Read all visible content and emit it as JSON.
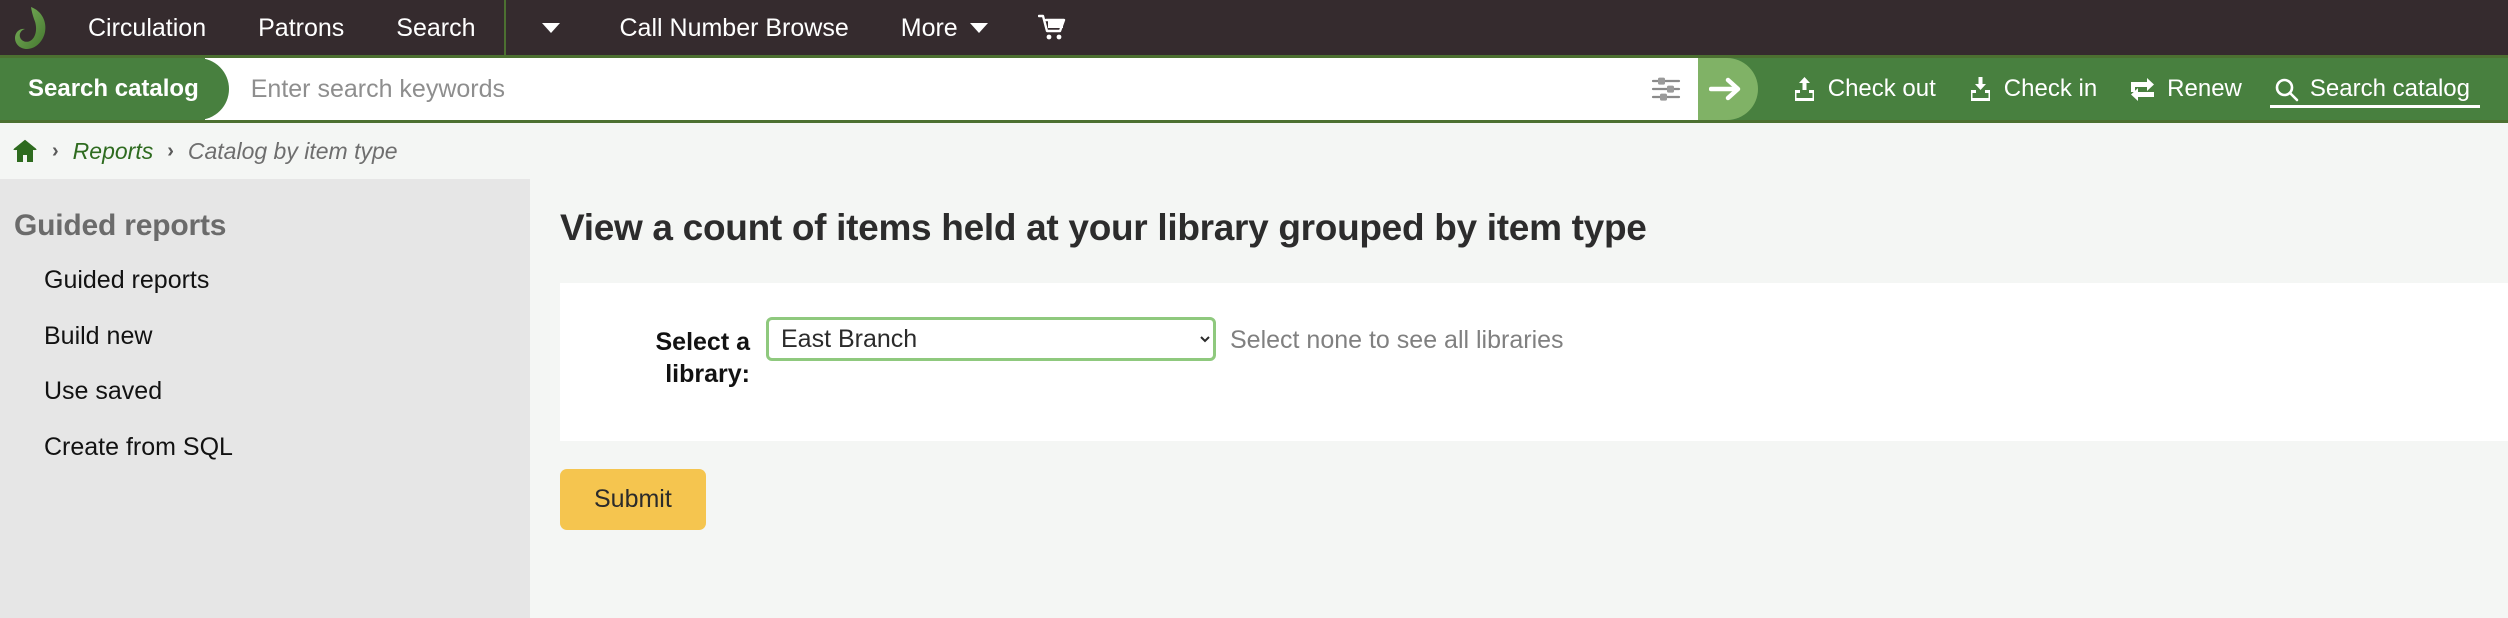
{
  "nav": {
    "logo_label": "koha-leaf-logo",
    "items": [
      {
        "label": "Circulation",
        "name": "nav-circulation"
      },
      {
        "label": "Patrons",
        "name": "nav-patrons"
      },
      {
        "label": "Search",
        "name": "nav-search"
      }
    ],
    "dropdown_caret_label": "",
    "call_number_browse": "Call Number Browse",
    "more": "More",
    "cart_label": "cart-icon"
  },
  "search": {
    "tab_label": "Search catalog",
    "placeholder": "Enter search keywords",
    "value": "",
    "filter_icon": "sliders-icon",
    "submit_icon": "arrow-right-icon",
    "actions": [
      {
        "label": "Check out",
        "icon": "check-out-icon",
        "active": false
      },
      {
        "label": "Check in",
        "icon": "check-in-icon",
        "active": false
      },
      {
        "label": "Renew",
        "icon": "renew-icon",
        "active": false
      },
      {
        "label": "Search catalog",
        "icon": "magnifier-icon",
        "active": true
      }
    ]
  },
  "breadcrumb": {
    "home_icon": "home-icon",
    "separator": "›",
    "items": [
      {
        "label": "Reports",
        "link": true
      },
      {
        "label": "Catalog by item type",
        "link": false
      }
    ]
  },
  "sidebar": {
    "heading": "Guided reports",
    "items": [
      {
        "label": "Guided reports"
      },
      {
        "label": "Build new"
      },
      {
        "label": "Use saved"
      },
      {
        "label": "Create from SQL"
      }
    ]
  },
  "main": {
    "title": "View a count of items held at your library grouped by item type",
    "form": {
      "label": "Select a library:",
      "selected_library": "East Branch",
      "library_options": [
        "East Branch"
      ],
      "hint": "Select none to see all libraries",
      "submit_label": "Submit"
    }
  },
  "colors": {
    "topbar_bg": "#352b2e",
    "brand_green": "#48803f",
    "accent_green": "#4c7031",
    "go_green": "#80b266",
    "submit_yellow": "#f5c54f",
    "sidebar_bg": "#e6e6e6",
    "body_bg": "#f4f6f4",
    "link_green": "#2e6b1f"
  }
}
